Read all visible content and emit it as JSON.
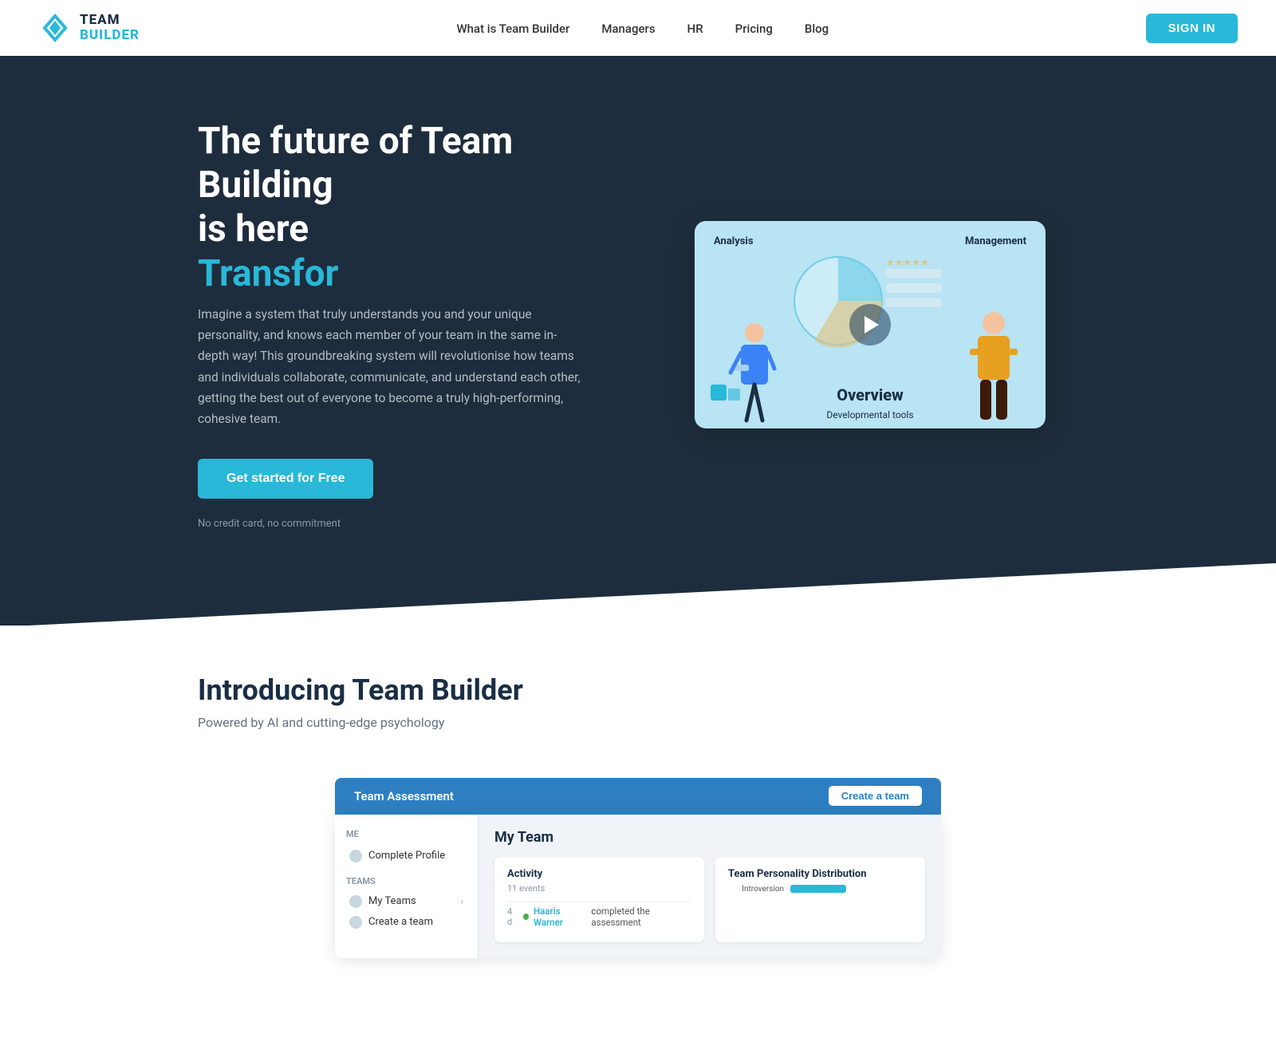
{
  "navbar": {
    "logo_team": "TEAM",
    "logo_builder": "BUILDER",
    "nav_items": [
      {
        "label": "What is Team Builder",
        "href": "#"
      },
      {
        "label": "Managers",
        "href": "#"
      },
      {
        "label": "HR",
        "href": "#"
      },
      {
        "label": "Pricing",
        "href": "#"
      },
      {
        "label": "Blog",
        "href": "#"
      }
    ],
    "signin_label": "SIGN IN"
  },
  "hero": {
    "title_line1": "The future of Team Building",
    "title_line2": "is here",
    "title_accent": "Transfor",
    "description": "Imagine a system that truly understands you and your unique personality, and knows each member of your team in the same in-depth way! This groundbreaking system will revolutionise how teams and individuals collaborate, communicate, and understand each other, getting the best out of everyone to become a truly high-performing, cohesive team.",
    "cta_label": "Get started for Free",
    "no_credit": "No credit card, no commitment",
    "video": {
      "label_left": "Analysis",
      "label_right": "Management",
      "center_label": "Overview",
      "bottom_label": "Developmental tools"
    }
  },
  "introducing": {
    "title": "Introducing Team Builder",
    "subtitle": "Powered by AI and cutting-edge psychology",
    "dashboard": {
      "bar_title": "Team Assessment",
      "bar_btn": "Create a team",
      "my_team": "My Team",
      "sidebar": {
        "me_label": "ME",
        "item1": "Complete Profile",
        "teams_label": "TEAMS",
        "item2": "My Teams",
        "item3": "Create a team"
      },
      "activity": {
        "title": "Activity",
        "subtitle": "11 events",
        "time": "4 d",
        "person": "Haaris Warner",
        "action": "completed the assessment"
      },
      "personality": {
        "title": "Team Personality Distribution",
        "label": "Introversion",
        "bar_width": "70"
      }
    }
  }
}
